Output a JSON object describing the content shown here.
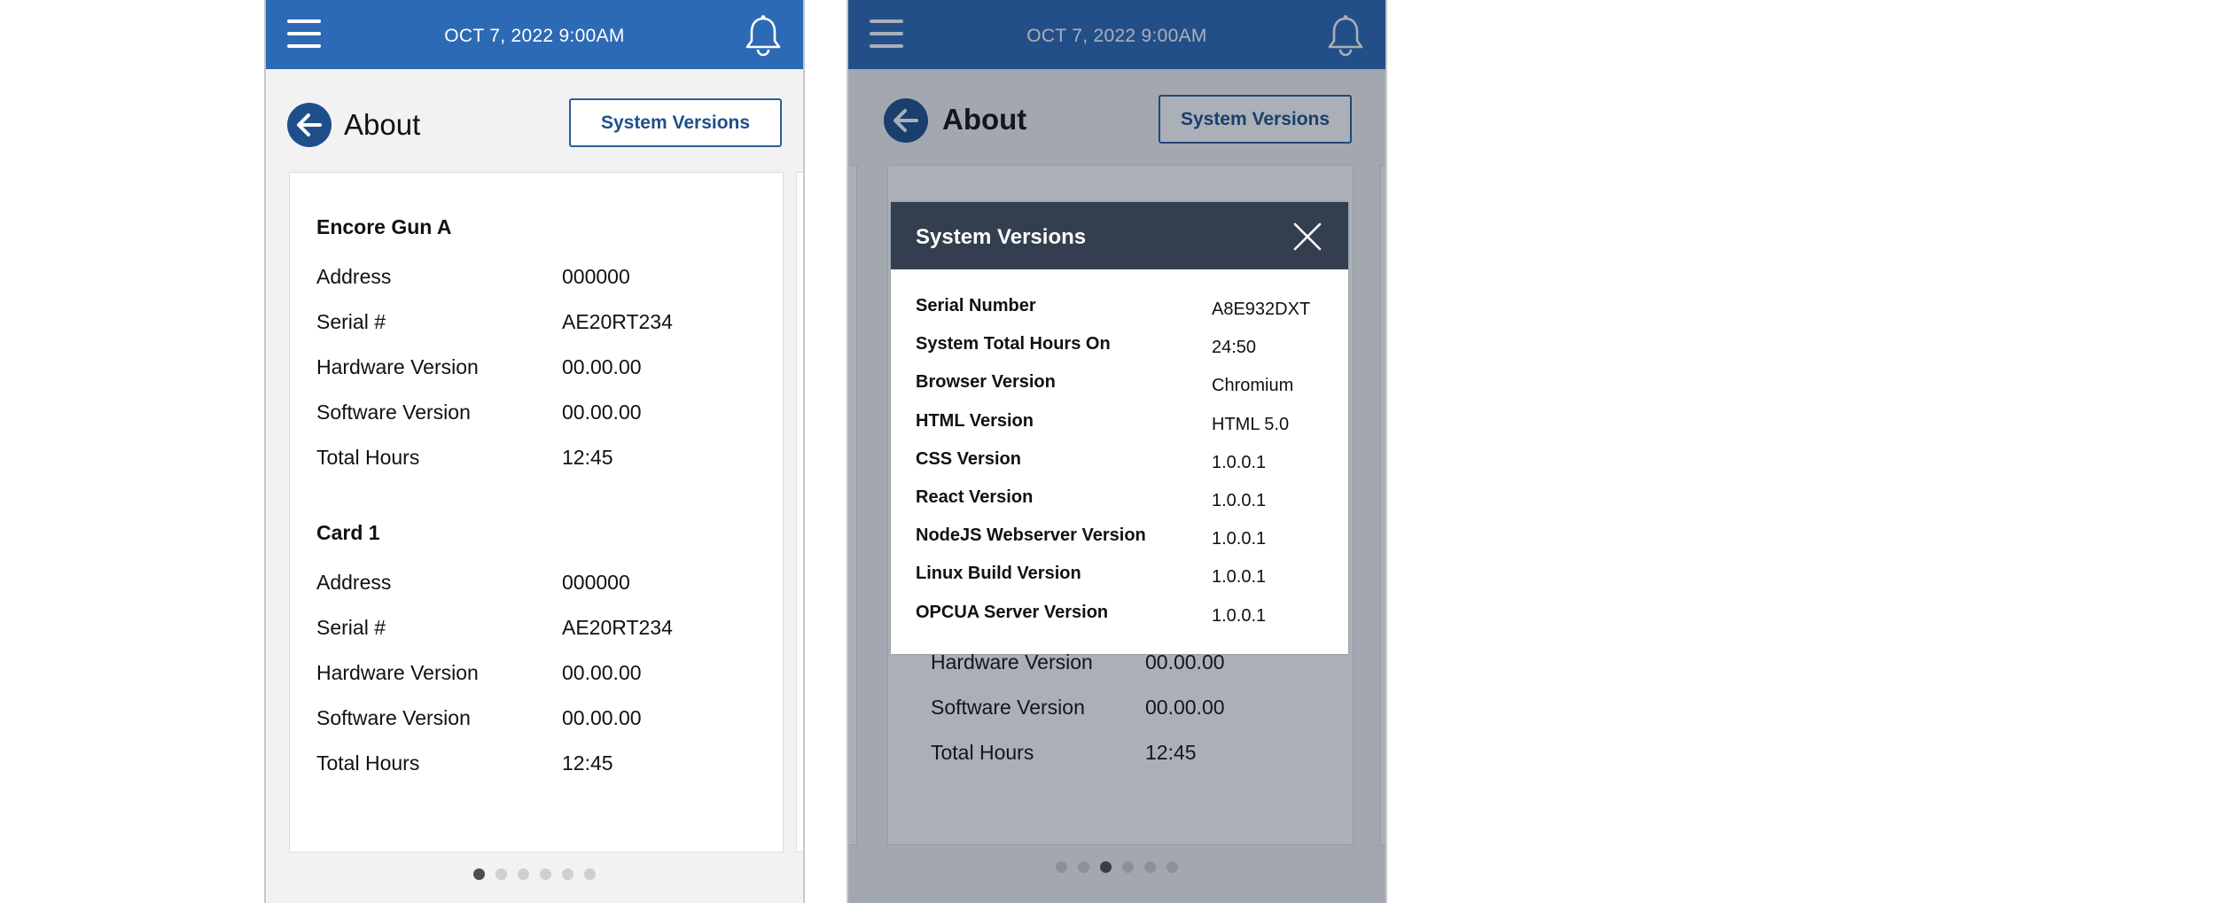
{
  "header": {
    "datetime": "OCT 7, 2022 9:00AM"
  },
  "page": {
    "title": "About",
    "system_versions_button": "System Versions"
  },
  "screen1": {
    "sections": [
      {
        "title": "Encore Gun A",
        "rows": [
          {
            "label": "Address",
            "value": "000000"
          },
          {
            "label": "Serial #",
            "value": "AE20RT234"
          },
          {
            "label": "Hardware Version",
            "value": "00.00.00"
          },
          {
            "label": "Software Version",
            "value": "00.00.00"
          },
          {
            "label": "Total Hours",
            "value": "12:45"
          }
        ]
      },
      {
        "title": "Card 1",
        "rows": [
          {
            "label": "Address",
            "value": "000000"
          },
          {
            "label": "Serial #",
            "value": "AE20RT234"
          },
          {
            "label": "Hardware Version",
            "value": "00.00.00"
          },
          {
            "label": "Software Version",
            "value": "00.00.00"
          },
          {
            "label": "Total Hours",
            "value": "12:45"
          }
        ]
      }
    ],
    "pagination": {
      "count": 6,
      "active_index": 0
    }
  },
  "screen2": {
    "background_rows": [
      {
        "label": "Hardware Version",
        "value": "00.00.00"
      },
      {
        "label": "Software Version",
        "value": "00.00.00"
      },
      {
        "label": "Total Hours",
        "value": "12:45"
      }
    ],
    "pagination": {
      "count": 6,
      "active_index": 2
    },
    "modal": {
      "title": "System Versions",
      "rows": [
        {
          "label": "Serial Number",
          "value": "A8E932DXT"
        },
        {
          "label": "System Total Hours On",
          "value": "24:50"
        },
        {
          "label": "Browser Version",
          "value": "Chromium"
        },
        {
          "label": "HTML Version",
          "value": "HTML 5.0"
        },
        {
          "label": "CSS Version",
          "value": "1.0.0.1"
        },
        {
          "label": "React Version",
          "value": "1.0.0.1"
        },
        {
          "label": "NodeJS Webserver Version",
          "value": "1.0.0.1"
        },
        {
          "label": "Linux Build Version",
          "value": "1.0.0.1"
        },
        {
          "label": "OPCUA Server Version",
          "value": "1.0.0.1"
        }
      ]
    }
  },
  "icons": {
    "menu": "menu-icon",
    "bell": "bell-icon",
    "back": "arrow-left-icon",
    "close": "close-icon"
  },
  "colors": {
    "header_blue": "#2c6ab5",
    "modal_header": "#333f4f",
    "button_border": "#2c5f9a"
  }
}
